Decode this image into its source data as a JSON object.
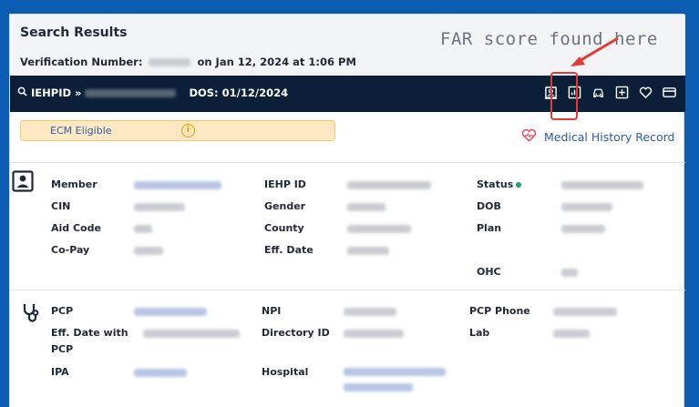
{
  "header": {
    "title": "Search Results",
    "verification_label": "Verification Number:",
    "verification_suffix": "on Jan 12, 2024 at 1:06 PM"
  },
  "annotation": {
    "text": "FAR score found here",
    "color": "#e53935"
  },
  "navbar": {
    "iehpid_label": "IEHPID »",
    "dos": "DOS: 01/12/2024",
    "icons": [
      "id-card-icon",
      "bar-chart-icon",
      "car-icon",
      "plus-square-icon",
      "heart-icon",
      "credit-card-icon"
    ]
  },
  "badge": {
    "label": "ECM Eligible",
    "info": "i"
  },
  "medical_history": {
    "label": "Medical History Record"
  },
  "member_section": {
    "col1": [
      "Member",
      "CIN",
      "Aid Code",
      "Co-Pay"
    ],
    "col2": [
      "IEHP ID",
      "Gender",
      "County",
      "Eff. Date"
    ],
    "col3": [
      "Status",
      "DOB",
      "Plan",
      "OHC"
    ]
  },
  "provider_section": {
    "col1": [
      "PCP",
      "Eff. Date with",
      "PCP",
      "IPA"
    ],
    "col2": [
      "NPI",
      "Directory ID",
      "Hospital"
    ],
    "col3": [
      "PCP Phone",
      "Lab"
    ]
  },
  "colors": {
    "frame": "#0a5db3",
    "navbar": "#0b2038",
    "link": "#2f5aa8",
    "highlight": "#e53935",
    "status": "#22a55a",
    "badge_bg": "#fde8c2"
  }
}
